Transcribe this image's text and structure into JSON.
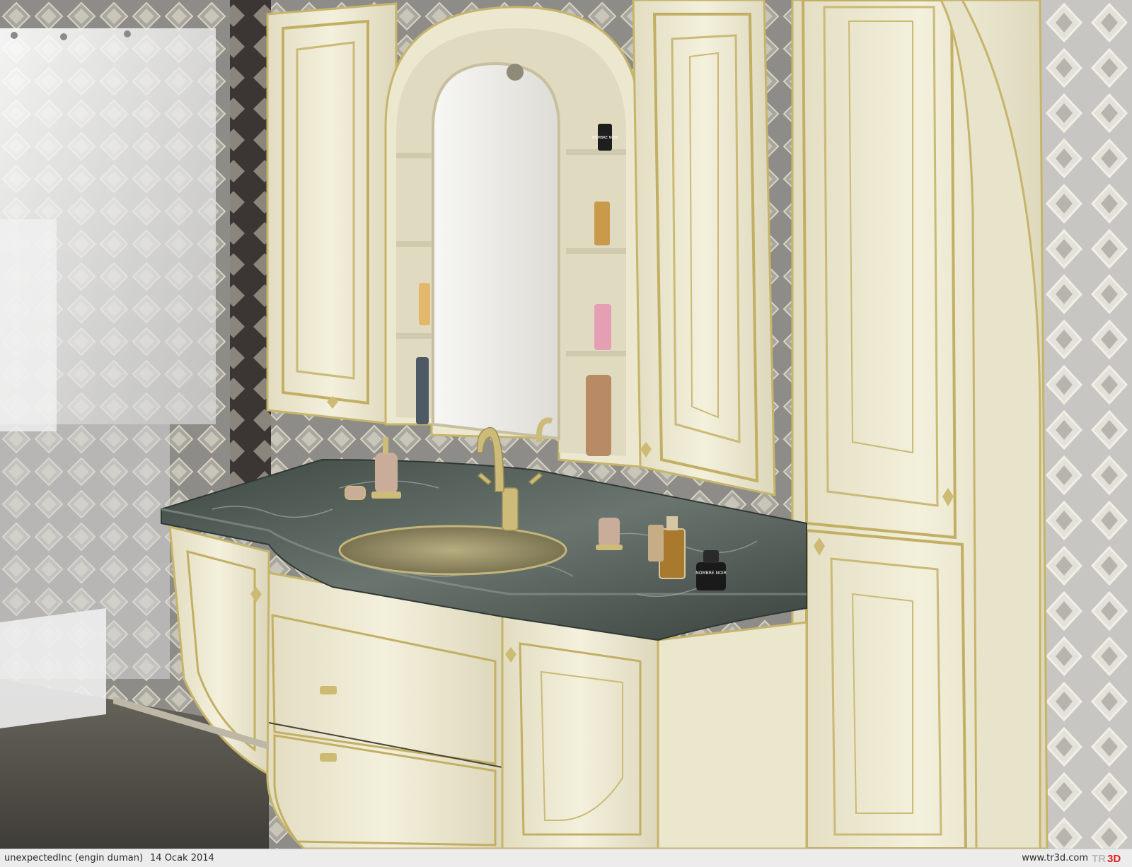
{
  "image": {
    "description_colors": {
      "cabinet": "#eeeacf",
      "trim": "#c8b56a",
      "marble": "#4f5a54",
      "wall_tile": "#8c8a86",
      "mirror": "#f3f3f1",
      "floor": "#5d5a52"
    }
  },
  "bottle_labels": {
    "perfume_counter": "NOMBRE NOIR",
    "perfume_shelf": "NOMBRE NOIR"
  },
  "footer": {
    "credit": "unexpectedInc (engin duman)",
    "date": "14 Ocak 2014",
    "site": "www.tr3d.com",
    "logo_text": "TR3D",
    "logo_colors": {
      "tr": "#b9b9b9",
      "3d": "#e0211b"
    }
  }
}
